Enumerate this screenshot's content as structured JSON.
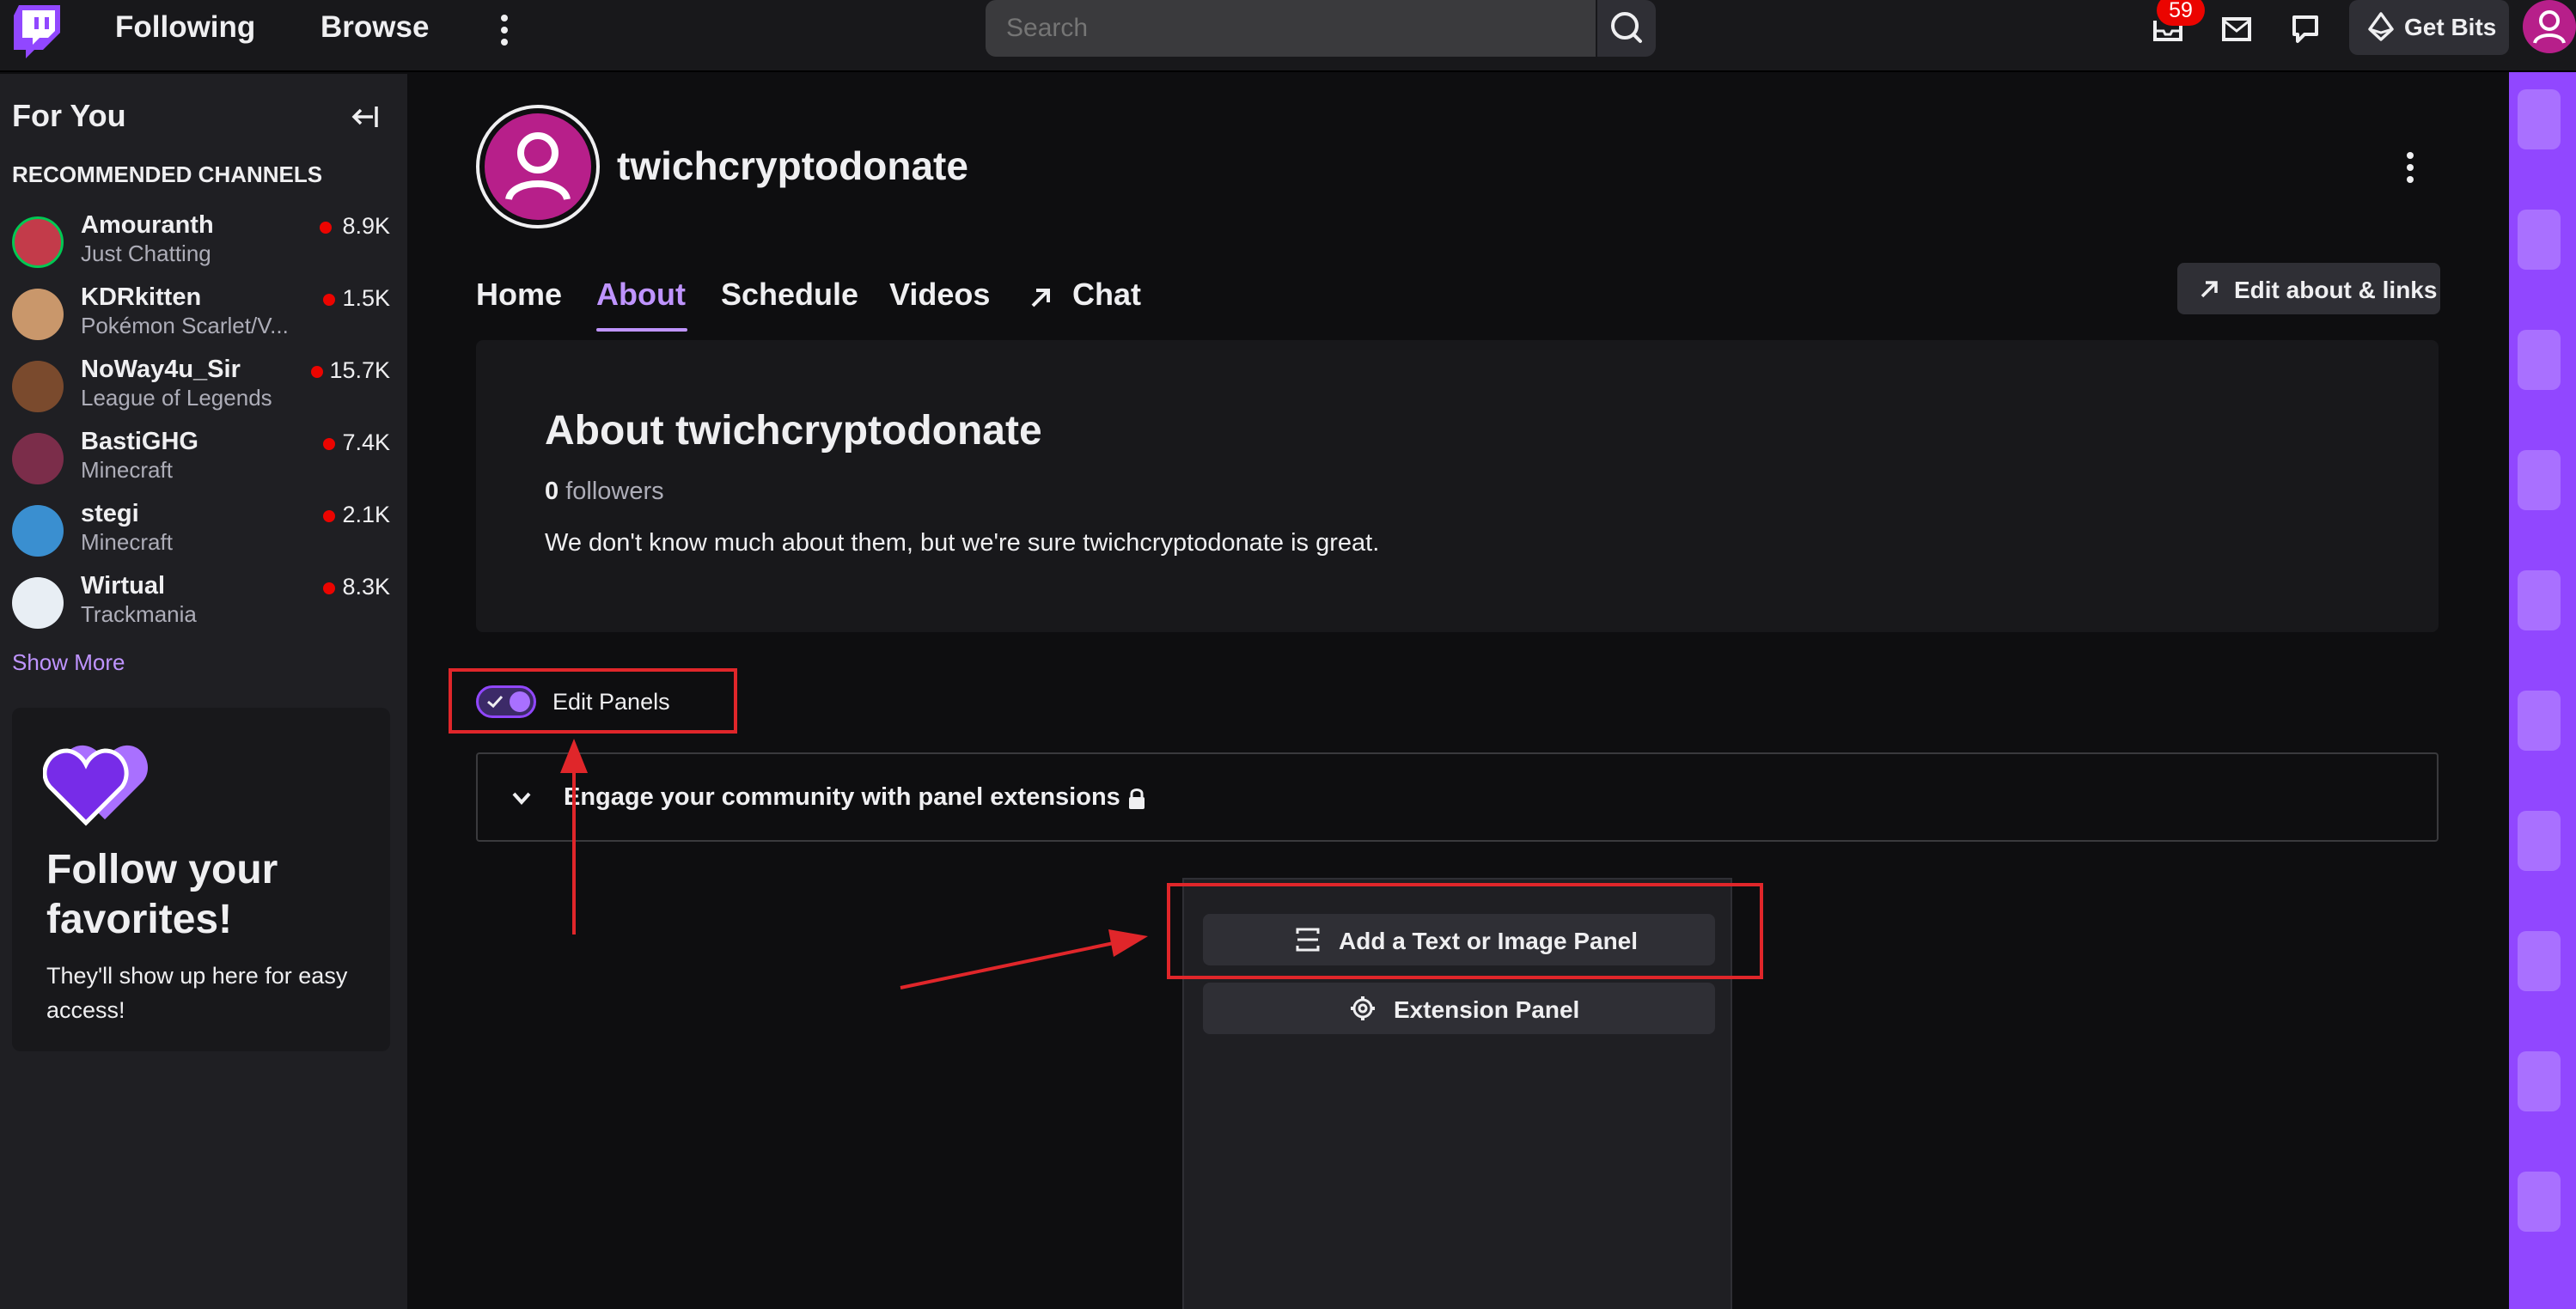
{
  "topbar": {
    "following": "Following",
    "browse": "Browse",
    "search_placeholder": "Search",
    "notification_count": "59",
    "get_bits": "Get Bits"
  },
  "sidebar": {
    "for_you": "For You",
    "recommended": "RECOMMENDED CHANNELS",
    "channels": [
      {
        "name": "Amouranth",
        "game": "Just Chatting",
        "viewers": "8.9K",
        "color": "#c33b4a"
      },
      {
        "name": "KDRkitten",
        "game": "Pokémon Scarlet/V...",
        "viewers": "1.5K",
        "color": "#c9976b"
      },
      {
        "name": "NoWay4u_Sir",
        "game": "League of Legends",
        "viewers": "15.7K",
        "color": "#7a4a2d"
      },
      {
        "name": "BastiGHG",
        "game": "Minecraft",
        "viewers": "7.4K",
        "color": "#7b2d4a"
      },
      {
        "name": "stegi",
        "game": "Minecraft",
        "viewers": "2.1K",
        "color": "#3a8fd0"
      },
      {
        "name": "Wirtual",
        "game": "Trackmania",
        "viewers": "8.3K",
        "color": "#e8eef4"
      }
    ],
    "show_more": "Show More",
    "follow_title": "Follow your favorites!",
    "follow_sub": "They'll show up here for easy access!"
  },
  "channel": {
    "name": "twichcryptodonate",
    "tabs": [
      "Home",
      "About",
      "Schedule",
      "Videos",
      "Chat"
    ],
    "active_tab": "About",
    "edit_links": "Edit about & links",
    "about_title": "About twichcryptodonate",
    "followers_count": "0",
    "followers_label": "followers",
    "about_desc": "We don't know much about them, but we're sure twichcryptodonate is great."
  },
  "panels": {
    "edit_panels": "Edit Panels",
    "engage": "Engage your community with panel extensions",
    "add_text_image": "Add a Text or Image Panel",
    "extension_panel": "Extension Panel"
  },
  "colors": {
    "accent": "#bf94ff",
    "brand": "#9147ff",
    "live": "#eb0400",
    "annotation": "#e0262a"
  }
}
